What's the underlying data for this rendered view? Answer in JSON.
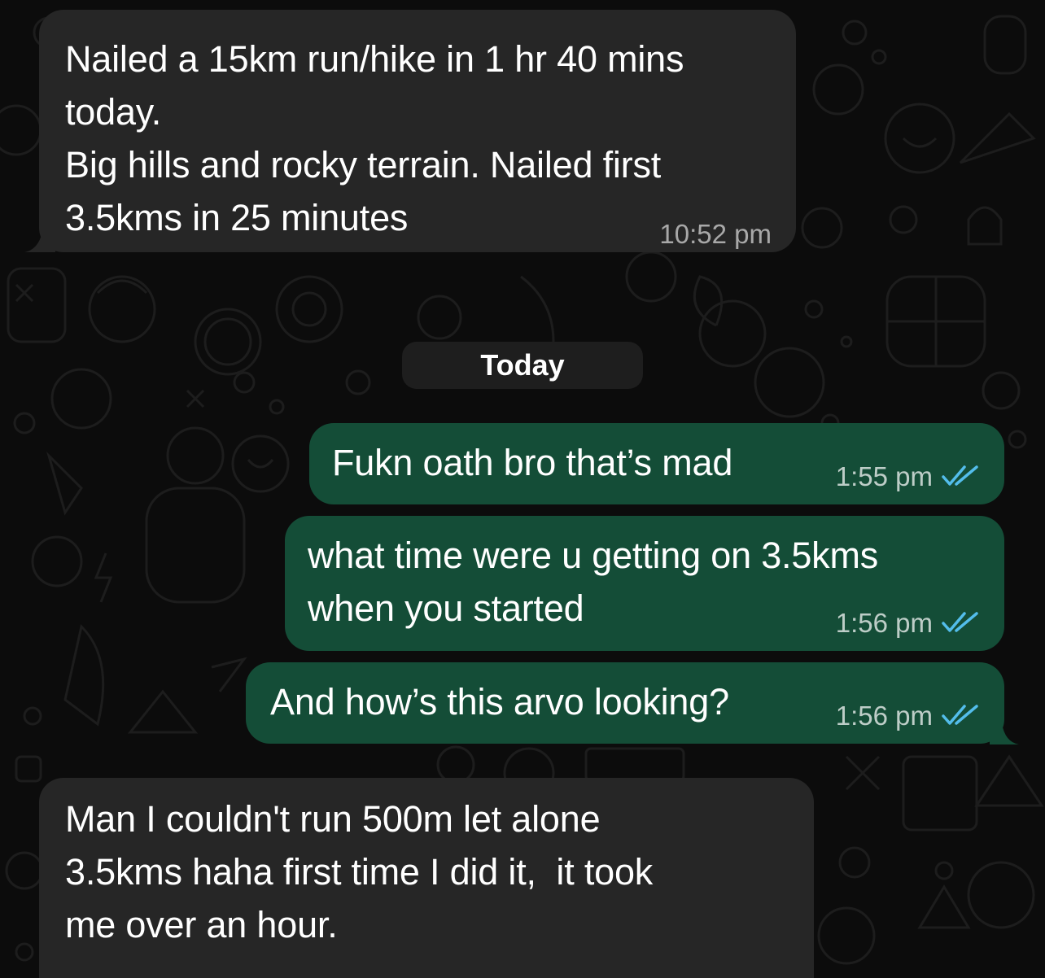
{
  "messages": [
    {
      "direction": "incoming",
      "text": "Nailed a 15km run/hike in 1 hr 40 mins\ntoday.\nBig hills and rocky terrain. Nailed first\n3.5kms in 25 minutes",
      "time": "10:52 pm"
    },
    {
      "direction": "outgoing",
      "text": "Fukn oath bro that’s mad",
      "time": "1:55 pm",
      "status": "read"
    },
    {
      "direction": "outgoing",
      "text": "what time were u getting on 3.5kms\nwhen you started",
      "time": "1:56 pm",
      "status": "read"
    },
    {
      "direction": "outgoing",
      "text": "And how’s this arvo looking?",
      "time": "1:56 pm",
      "status": "read"
    },
    {
      "direction": "incoming",
      "text": "Man I couldn't run 500m let alone\n3.5kms haha first time I did it,  it took\nme over an hour.",
      "time": ""
    }
  ],
  "date_divider": "Today",
  "colors": {
    "incoming_bubble": "#262626",
    "outgoing_bubble": "#144d37",
    "read_ticks": "#53bdeb",
    "wallpaper_doodle": "#1c1c1c"
  },
  "icons": {
    "read_receipt": "double-check-icon",
    "wallpaper": "doodle-pattern"
  }
}
